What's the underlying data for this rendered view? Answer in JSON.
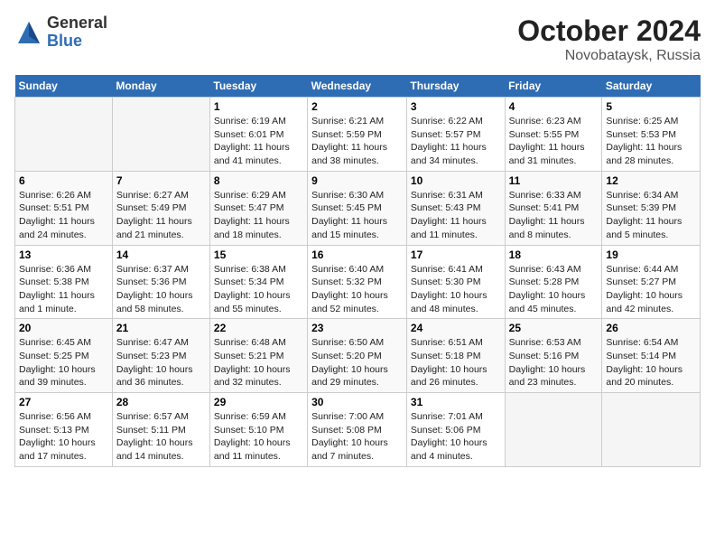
{
  "header": {
    "logo_general": "General",
    "logo_blue": "Blue",
    "month_year": "October 2024",
    "location": "Novobataysk, Russia"
  },
  "weekdays": [
    "Sunday",
    "Monday",
    "Tuesday",
    "Wednesday",
    "Thursday",
    "Friday",
    "Saturday"
  ],
  "weeks": [
    [
      {
        "day": "",
        "empty": true
      },
      {
        "day": "",
        "empty": true
      },
      {
        "day": "1",
        "sunrise": "6:19 AM",
        "sunset": "6:01 PM",
        "daylight": "11 hours and 41 minutes."
      },
      {
        "day": "2",
        "sunrise": "6:21 AM",
        "sunset": "5:59 PM",
        "daylight": "11 hours and 38 minutes."
      },
      {
        "day": "3",
        "sunrise": "6:22 AM",
        "sunset": "5:57 PM",
        "daylight": "11 hours and 34 minutes."
      },
      {
        "day": "4",
        "sunrise": "6:23 AM",
        "sunset": "5:55 PM",
        "daylight": "11 hours and 31 minutes."
      },
      {
        "day": "5",
        "sunrise": "6:25 AM",
        "sunset": "5:53 PM",
        "daylight": "11 hours and 28 minutes."
      }
    ],
    [
      {
        "day": "6",
        "sunrise": "6:26 AM",
        "sunset": "5:51 PM",
        "daylight": "11 hours and 24 minutes."
      },
      {
        "day": "7",
        "sunrise": "6:27 AM",
        "sunset": "5:49 PM",
        "daylight": "11 hours and 21 minutes."
      },
      {
        "day": "8",
        "sunrise": "6:29 AM",
        "sunset": "5:47 PM",
        "daylight": "11 hours and 18 minutes."
      },
      {
        "day": "9",
        "sunrise": "6:30 AM",
        "sunset": "5:45 PM",
        "daylight": "11 hours and 15 minutes."
      },
      {
        "day": "10",
        "sunrise": "6:31 AM",
        "sunset": "5:43 PM",
        "daylight": "11 hours and 11 minutes."
      },
      {
        "day": "11",
        "sunrise": "6:33 AM",
        "sunset": "5:41 PM",
        "daylight": "11 hours and 8 minutes."
      },
      {
        "day": "12",
        "sunrise": "6:34 AM",
        "sunset": "5:39 PM",
        "daylight": "11 hours and 5 minutes."
      }
    ],
    [
      {
        "day": "13",
        "sunrise": "6:36 AM",
        "sunset": "5:38 PM",
        "daylight": "11 hours and 1 minute."
      },
      {
        "day": "14",
        "sunrise": "6:37 AM",
        "sunset": "5:36 PM",
        "daylight": "10 hours and 58 minutes."
      },
      {
        "day": "15",
        "sunrise": "6:38 AM",
        "sunset": "5:34 PM",
        "daylight": "10 hours and 55 minutes."
      },
      {
        "day": "16",
        "sunrise": "6:40 AM",
        "sunset": "5:32 PM",
        "daylight": "10 hours and 52 minutes."
      },
      {
        "day": "17",
        "sunrise": "6:41 AM",
        "sunset": "5:30 PM",
        "daylight": "10 hours and 48 minutes."
      },
      {
        "day": "18",
        "sunrise": "6:43 AM",
        "sunset": "5:28 PM",
        "daylight": "10 hours and 45 minutes."
      },
      {
        "day": "19",
        "sunrise": "6:44 AM",
        "sunset": "5:27 PM",
        "daylight": "10 hours and 42 minutes."
      }
    ],
    [
      {
        "day": "20",
        "sunrise": "6:45 AM",
        "sunset": "5:25 PM",
        "daylight": "10 hours and 39 minutes."
      },
      {
        "day": "21",
        "sunrise": "6:47 AM",
        "sunset": "5:23 PM",
        "daylight": "10 hours and 36 minutes."
      },
      {
        "day": "22",
        "sunrise": "6:48 AM",
        "sunset": "5:21 PM",
        "daylight": "10 hours and 32 minutes."
      },
      {
        "day": "23",
        "sunrise": "6:50 AM",
        "sunset": "5:20 PM",
        "daylight": "10 hours and 29 minutes."
      },
      {
        "day": "24",
        "sunrise": "6:51 AM",
        "sunset": "5:18 PM",
        "daylight": "10 hours and 26 minutes."
      },
      {
        "day": "25",
        "sunrise": "6:53 AM",
        "sunset": "5:16 PM",
        "daylight": "10 hours and 23 minutes."
      },
      {
        "day": "26",
        "sunrise": "6:54 AM",
        "sunset": "5:14 PM",
        "daylight": "10 hours and 20 minutes."
      }
    ],
    [
      {
        "day": "27",
        "sunrise": "6:56 AM",
        "sunset": "5:13 PM",
        "daylight": "10 hours and 17 minutes."
      },
      {
        "day": "28",
        "sunrise": "6:57 AM",
        "sunset": "5:11 PM",
        "daylight": "10 hours and 14 minutes."
      },
      {
        "day": "29",
        "sunrise": "6:59 AM",
        "sunset": "5:10 PM",
        "daylight": "10 hours and 11 minutes."
      },
      {
        "day": "30",
        "sunrise": "7:00 AM",
        "sunset": "5:08 PM",
        "daylight": "10 hours and 7 minutes."
      },
      {
        "day": "31",
        "sunrise": "7:01 AM",
        "sunset": "5:06 PM",
        "daylight": "10 hours and 4 minutes."
      },
      {
        "day": "",
        "empty": true
      },
      {
        "day": "",
        "empty": true
      }
    ]
  ]
}
